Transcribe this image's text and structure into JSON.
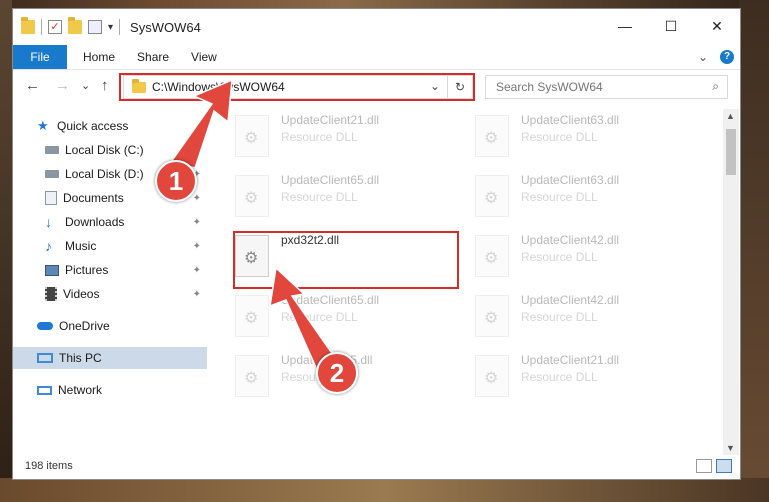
{
  "window": {
    "title": "SysWOW64",
    "controls": {
      "minimize": "—",
      "maximize": "☐",
      "close": "✕"
    }
  },
  "ribbon": {
    "file_tab": "File",
    "tabs": [
      "Home",
      "Share",
      "View"
    ],
    "expand_glyph": "⌄",
    "help_glyph": "?"
  },
  "nav": {
    "back_glyph": "←",
    "forward_glyph": "→",
    "recent_glyph": "⌄",
    "up_glyph": "↑",
    "address_path": "C:\\Windows\\SysWOW64",
    "address_dropdown_glyph": "⌄",
    "refresh_glyph": "↻",
    "search_placeholder": "Search SysWOW64",
    "search_glyph": "⌕"
  },
  "sidebar": {
    "items": [
      {
        "label": "Quick access",
        "icon": "star-icon",
        "color": "#1e78d7"
      },
      {
        "label": "Local Disk (C:)",
        "icon": "drive-icon",
        "color": "#6a7a8a"
      },
      {
        "label": "Local Disk (D:)",
        "icon": "drive-icon",
        "color": "#6a7a8a"
      },
      {
        "label": "Documents",
        "icon": "documents-icon",
        "color": "#8899aa"
      },
      {
        "label": "Downloads",
        "icon": "download-icon",
        "color": "#1e78d7"
      },
      {
        "label": "Music",
        "icon": "music-icon",
        "color": "#1e78d7"
      },
      {
        "label": "Pictures",
        "icon": "pictures-icon",
        "color": "#5a88b8"
      },
      {
        "label": "Videos",
        "icon": "videos-icon",
        "color": "#444444"
      },
      {
        "label": "OneDrive",
        "icon": "cloud-icon",
        "color": "#1e78d7"
      },
      {
        "label": "This PC",
        "icon": "computer-icon",
        "color": "#3c8ad8"
      },
      {
        "label": "Network",
        "icon": "network-icon",
        "color": "#3c8ad8"
      }
    ],
    "pin_glyph": "📌"
  },
  "files": [
    {
      "name": "UpdateClient21.dll",
      "type": "Resource DLL"
    },
    {
      "name": "UpdateClient63.dll",
      "type": "Resource DLL"
    },
    {
      "name": "UpdateClient65.dll",
      "type": "Resource DLL"
    },
    {
      "name": "UpdateClient63.dll",
      "type": "Resource DLL"
    },
    {
      "name": "pxd32t2.dll",
      "type": ""
    },
    {
      "name": "UpdateClient42.dll",
      "type": "Resource DLL"
    },
    {
      "name": "UpdateClient65.dll",
      "type": "Resource DLL"
    },
    {
      "name": "UpdateClient42.dll",
      "type": "Resource DLL"
    },
    {
      "name": "UpdateClient5.dll",
      "type": "Resource DLL"
    },
    {
      "name": "UpdateClient21.dll",
      "type": "Resource DLL"
    }
  ],
  "status": {
    "item_count": "198 items"
  },
  "annotations": {
    "step1": "1",
    "step2": "2",
    "accent": "#d72a2a"
  }
}
